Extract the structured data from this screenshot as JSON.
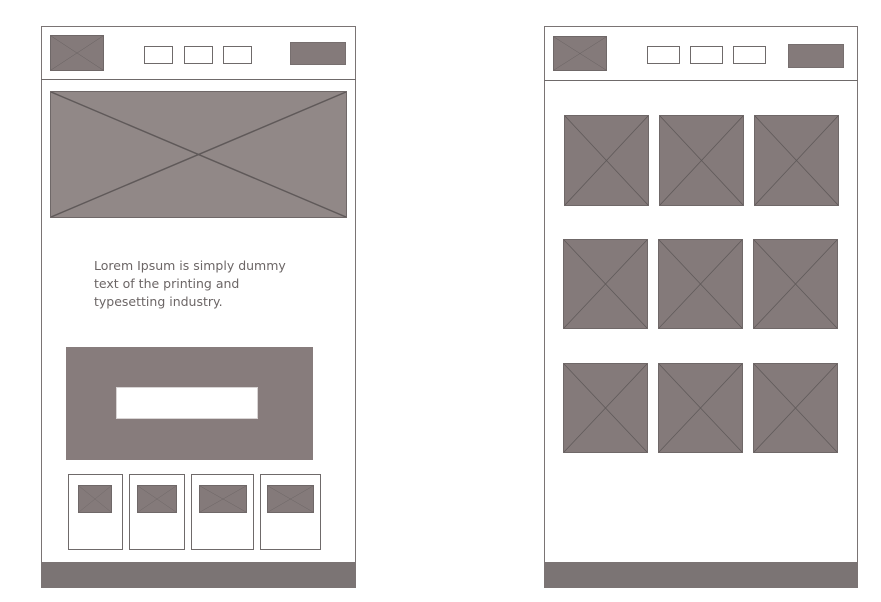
{
  "mobile_home": {
    "body_text": "Lorem Ipsum is simply dummy text of the printing and typesetting industry."
  },
  "icons": {
    "image_placeholder": "image-placeholder-icon"
  },
  "colors": {
    "placeholder_fill": "#847a7a",
    "outline": "#6f6a6a",
    "text": "#6c6666",
    "footer": "#7b7474",
    "background": "#ffffff"
  }
}
